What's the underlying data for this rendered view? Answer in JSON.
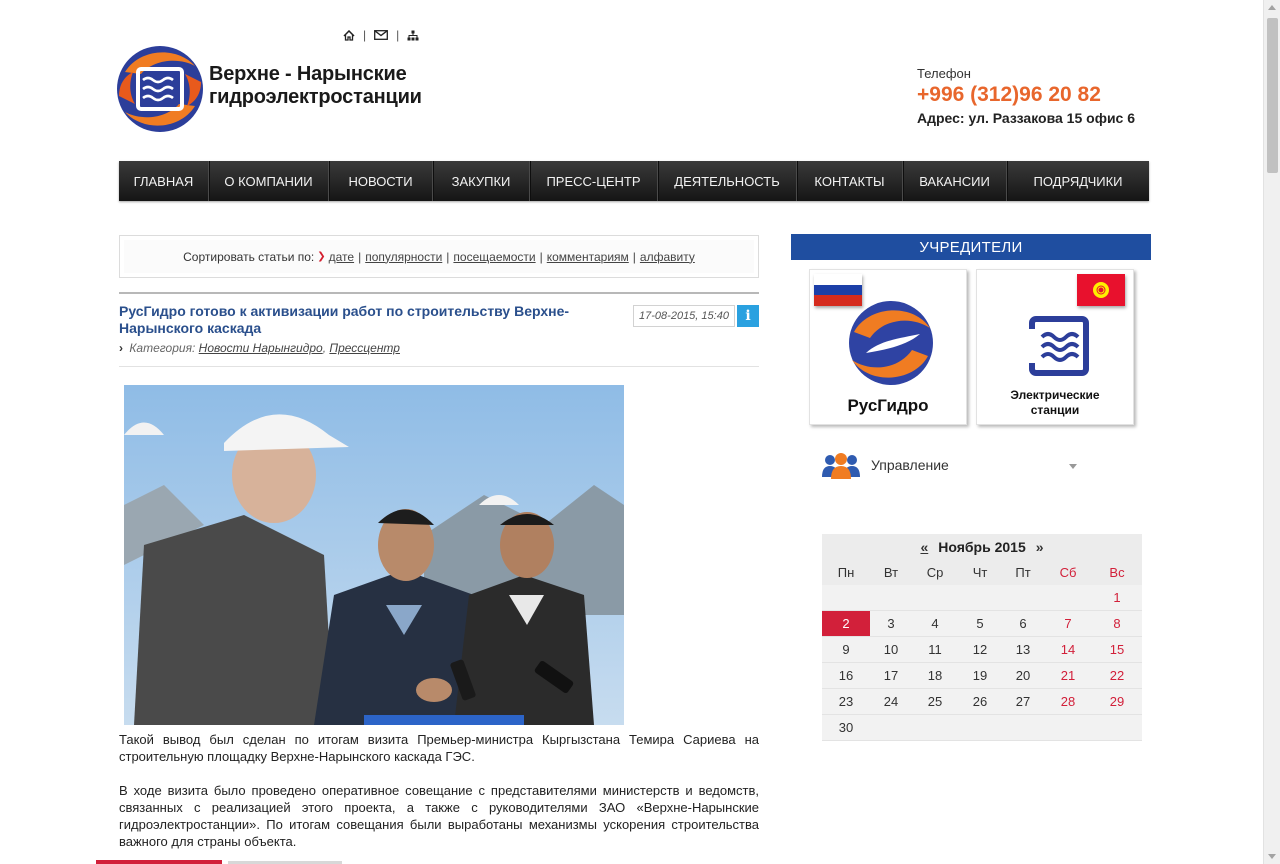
{
  "header": {
    "logo_line1": "Верхне - Нарынские",
    "logo_line2": "гидроэлектростанции",
    "util_icons": [
      "home-icon",
      "mail-icon",
      "sitemap-icon"
    ],
    "phone_label": "Телефон",
    "phone_number": "+996 (312)96 20 82",
    "address": "Адрес: ул. Раззакова 15 офис 6"
  },
  "nav": {
    "items": [
      {
        "label": "ГЛАВНАЯ"
      },
      {
        "label": "О КОМПАНИИ"
      },
      {
        "label": "НОВОСТИ"
      },
      {
        "label": "ЗАКУПКИ"
      },
      {
        "label": "ПРЕСС-ЦЕНТР"
      },
      {
        "label": "ДЕЯТЕЛЬНОСТЬ"
      },
      {
        "label": "КОНТАКТЫ"
      },
      {
        "label": "ВАКАНСИИ"
      },
      {
        "label": "ПОДРЯДЧИКИ"
      }
    ]
  },
  "sort": {
    "label": "Сортировать статьи по:",
    "options": [
      "дате",
      "популярности",
      "посещаемости",
      "комментариям",
      "алфавиту"
    ]
  },
  "article": {
    "title": "РусГидро готово к активизации работ по строительству Верхне-Нарынского каскада",
    "date": "17-08-2015, 15:40",
    "info_label": "i",
    "category_label": "Категория:",
    "categories": [
      "Новости Нарынгидро",
      "Прессцентр"
    ],
    "paragraphs": [
      "Такой вывод был сделан по итогам визита Премьер-министра Кыргызстана Темира Сариева на строительную площадку Верхне-Нарынского каскада ГЭС.",
      "В ходе визита было проведено оперативное совещание с представителями министерств и ведомств, связанных с реализацией этого проекта, а также с руководителями ЗАО «Верхне-Нарынские гидроэлектростанции». По итогам совещания были выработаны механизмы ускорения строительства важного для страны объекта."
    ]
  },
  "sidebar": {
    "founders_title": "УЧРЕДИТЕЛИ",
    "founder1": "РусГидро",
    "founder2_line1": "Электрические",
    "founder2_line2": "станции",
    "management_label": "Управление"
  },
  "calendar": {
    "prev": "«",
    "next": "»",
    "month_title": "Ноябрь 2015",
    "weekdays": [
      "Пн",
      "Вт",
      "Ср",
      "Чт",
      "Пт",
      "Сб",
      "Вс"
    ],
    "weeks": [
      [
        "",
        "",
        "",
        "",
        "",
        "",
        "1"
      ],
      [
        "2",
        "3",
        "4",
        "5",
        "6",
        "7",
        "8"
      ],
      [
        "9",
        "10",
        "11",
        "12",
        "13",
        "14",
        "15"
      ],
      [
        "16",
        "17",
        "18",
        "19",
        "20",
        "21",
        "22"
      ],
      [
        "23",
        "24",
        "25",
        "26",
        "27",
        "28",
        "29"
      ],
      [
        "30",
        "",
        "",
        "",
        "",
        "",
        ""
      ]
    ],
    "today": "2",
    "colors": {
      "weekend": "#d2203a",
      "today_bg": "#d2203a"
    }
  },
  "colors": {
    "accent_orange": "#e8662c",
    "title_blue": "#2a4f8c",
    "founders_blue": "#1f4ea0",
    "info_blue": "#2aa1e0"
  }
}
